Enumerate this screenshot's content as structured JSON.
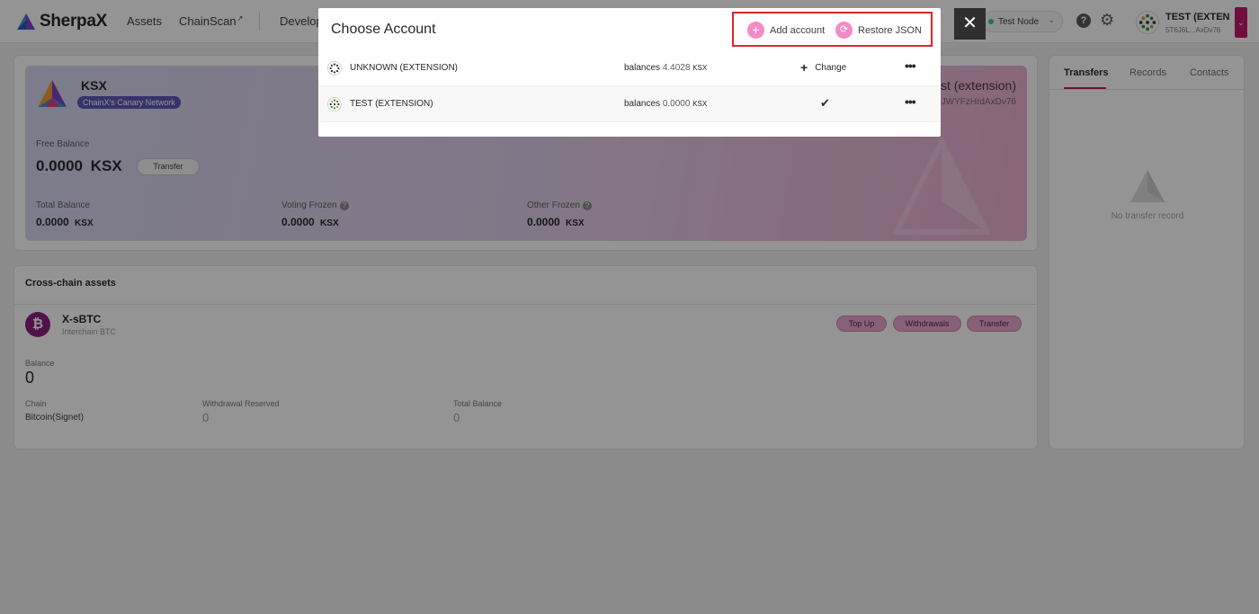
{
  "nav": {
    "logo": "SherpaX",
    "links": [
      "Assets",
      "ChainScan",
      "Develop"
    ],
    "node": "Test Node",
    "account_name": "TEST (EXTEN",
    "account_addr": "5T6J6L...AxDv76"
  },
  "asset": {
    "token": "KSX",
    "network_badge": "ChainX's Canary Network",
    "account_label": "est (extension)",
    "account_addr": "JWYFzHrdAxDv76",
    "free_label": "Free Balance",
    "free_value": "0.0000",
    "free_unit": "KSX",
    "transfer_label": "Transfer",
    "total_label": "Total Balance",
    "total_value": "0.0000",
    "total_unit": "KSX",
    "voting_label": "Voting Frozen",
    "voting_value": "0.0000",
    "voting_unit": "KSX",
    "other_label": "Other Frozen",
    "other_value": "0.0000",
    "other_unit": "KSX"
  },
  "cross": {
    "title": "Cross-chain assets",
    "coin_symbol": "₿",
    "coin_name": "X-sBTC",
    "coin_sub": "Interchain BTC",
    "buttons": {
      "topup": "Top Up",
      "withdrawals": "Withdrawals",
      "transfer": "Transfer"
    },
    "balance_label": "Balance",
    "balance_value": "0",
    "chain_label": "Chain",
    "chain_value": "Bitcoin(Signet)",
    "withdrawal_reserved_label": "Withdrawal Reserved",
    "withdrawal_reserved_value": "0",
    "total_balance_label": "Total Balance",
    "total_balance_value": "0"
  },
  "side": {
    "tabs": [
      "Transfers",
      "Records",
      "Contacts"
    ],
    "empty_text": "No transfer record"
  },
  "modal": {
    "title": "Choose Account",
    "add_account": "Add account",
    "restore_json": "Restore JSON",
    "close": "✕",
    "rows": [
      {
        "name": "UNKNOWN (EXTENSION)",
        "balances_label": "balances",
        "balance": "4.4028",
        "unit": "KSX",
        "action": "Change"
      },
      {
        "name": "TEST (EXTENSION)",
        "balances_label": "balances",
        "balance": "0.0000",
        "unit": "KSX",
        "action": "selected"
      }
    ]
  },
  "colors": {
    "accent": "#c21a6b",
    "modal_icon": "#f48bc4",
    "highlight_box": "#e0242b"
  }
}
